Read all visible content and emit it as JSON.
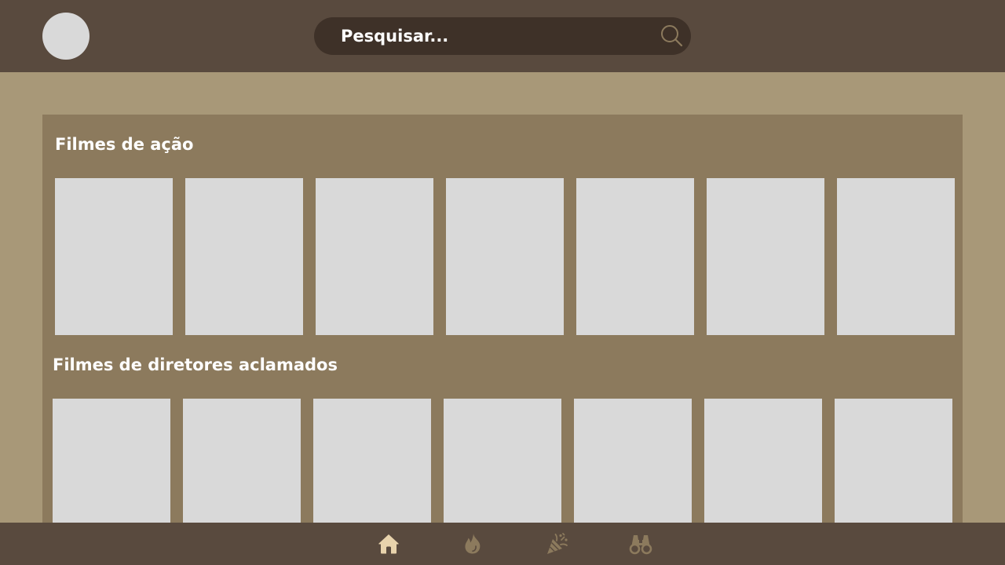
{
  "header": {
    "search": {
      "placeholder": "Pesquisar..."
    }
  },
  "sections": [
    {
      "title": "Filmes de ação",
      "cards": 7
    },
    {
      "title": "Filmes de diretores aclamados",
      "cards": 7
    }
  ],
  "bottom_nav": {
    "items": [
      {
        "icon": "home-icon",
        "active": true
      },
      {
        "icon": "flame-icon",
        "active": false
      },
      {
        "icon": "party-popper-icon",
        "active": false
      },
      {
        "icon": "binoculars-icon",
        "active": false
      }
    ]
  },
  "colors": {
    "header_bg": "#594a3e",
    "search_bg": "#3e3128",
    "page_bg": "#a89878",
    "panel_bg": "#8c7a5d",
    "card_bg": "#d9d9d9",
    "nav_active": "#e8d3ac",
    "nav_inactive": "#8c7a5d"
  }
}
